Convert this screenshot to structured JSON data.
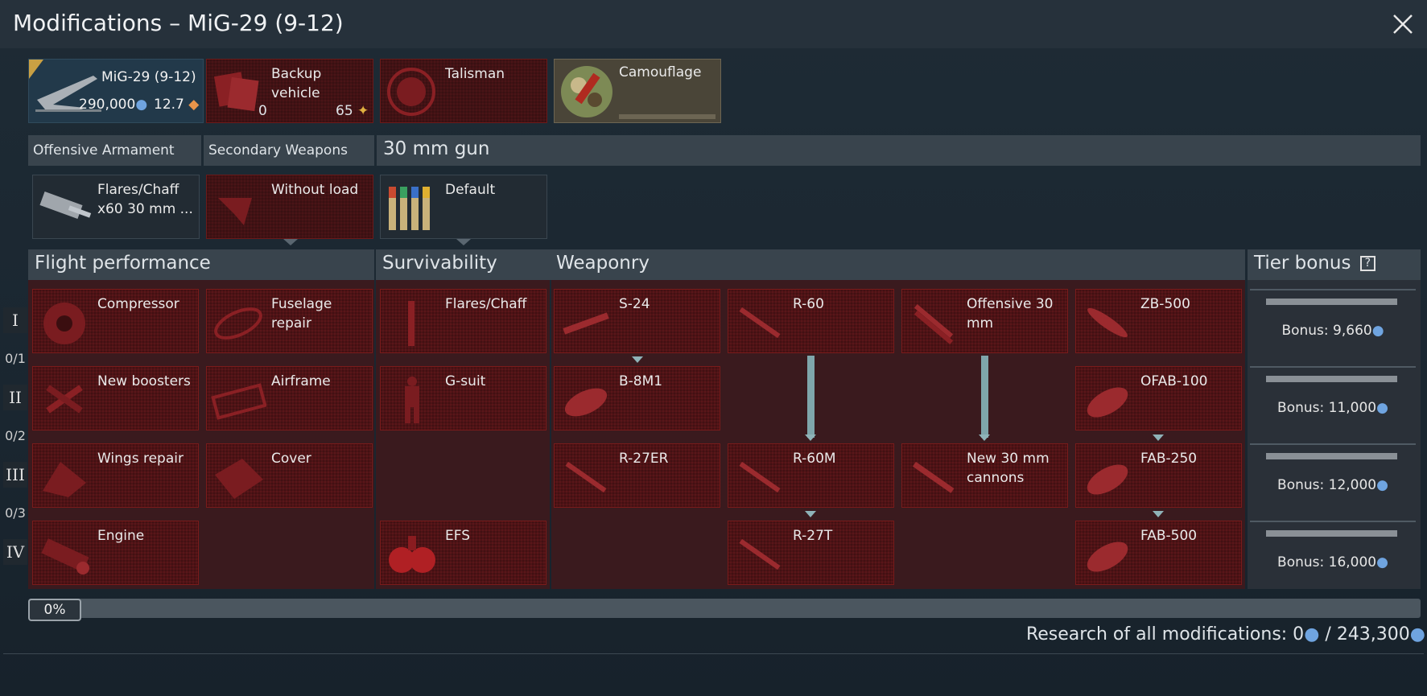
{
  "window": {
    "title": "Modifications – MiG-29 (9-12)"
  },
  "top_slots": {
    "vehicle": {
      "label": "MiG-29 (9-12)",
      "price": "290,000",
      "br": "12.7"
    },
    "backup": {
      "label": "Backup vehicle",
      "count": "0",
      "cost": "65"
    },
    "talisman": {
      "label": "Talisman"
    },
    "camouflage": {
      "label": "Camouflage"
    }
  },
  "weapon_headers": {
    "offensive": "Offensive Armament",
    "secondary": "Secondary Weapons",
    "gun": "30 mm gun"
  },
  "weapon_slots": {
    "offensive": "Flares/Chaff x60 30 mm ...",
    "secondary": "Without load",
    "gun": "Default"
  },
  "columns": {
    "flight": "Flight performance",
    "survivability": "Survivability",
    "weaponry": "Weaponry",
    "tier_bonus": "Tier bonus",
    "tier_help": "?"
  },
  "tiers": {
    "labels": [
      "I",
      "II",
      "III",
      "IV"
    ],
    "counts": [
      "0/1",
      "0/2",
      "0/3"
    ]
  },
  "mods": {
    "compressor": "Compressor",
    "fuselage_repair": "Fuselage repair",
    "new_boosters": "New boosters",
    "airframe": "Airframe",
    "wings_repair": "Wings repair",
    "cover": "Cover",
    "engine": "Engine",
    "flares_chaff": "Flares/Chaff",
    "g_suit": "G-suit",
    "efs": "EFS",
    "s24": "S-24",
    "b8m1": "B-8M1",
    "r27er": "R-27ER",
    "r60": "R-60",
    "r60m": "R-60M",
    "r27t": "R-27T",
    "offensive30": "Offensive 30 mm",
    "new30": "New 30 mm cannons",
    "zb500": "ZB-500",
    "ofab100": "OFAB-100",
    "fab250": "FAB-250",
    "fab500": "FAB-500"
  },
  "bonuses": [
    "Bonus: 9,660",
    "Bonus: 11,000",
    "Bonus: 12,000",
    "Bonus: 16,000"
  ],
  "progress": {
    "percent_label": "0%",
    "fraction": 0
  },
  "research": {
    "label": "Research of all modifications: 0",
    "separator": "/",
    "total": "243,300"
  },
  "colors": {
    "rp_icon": "#6fa4e0",
    "mod_bg": "#5a1619",
    "mod_border": "#7a1b1b",
    "header_bg": "#39444d"
  }
}
